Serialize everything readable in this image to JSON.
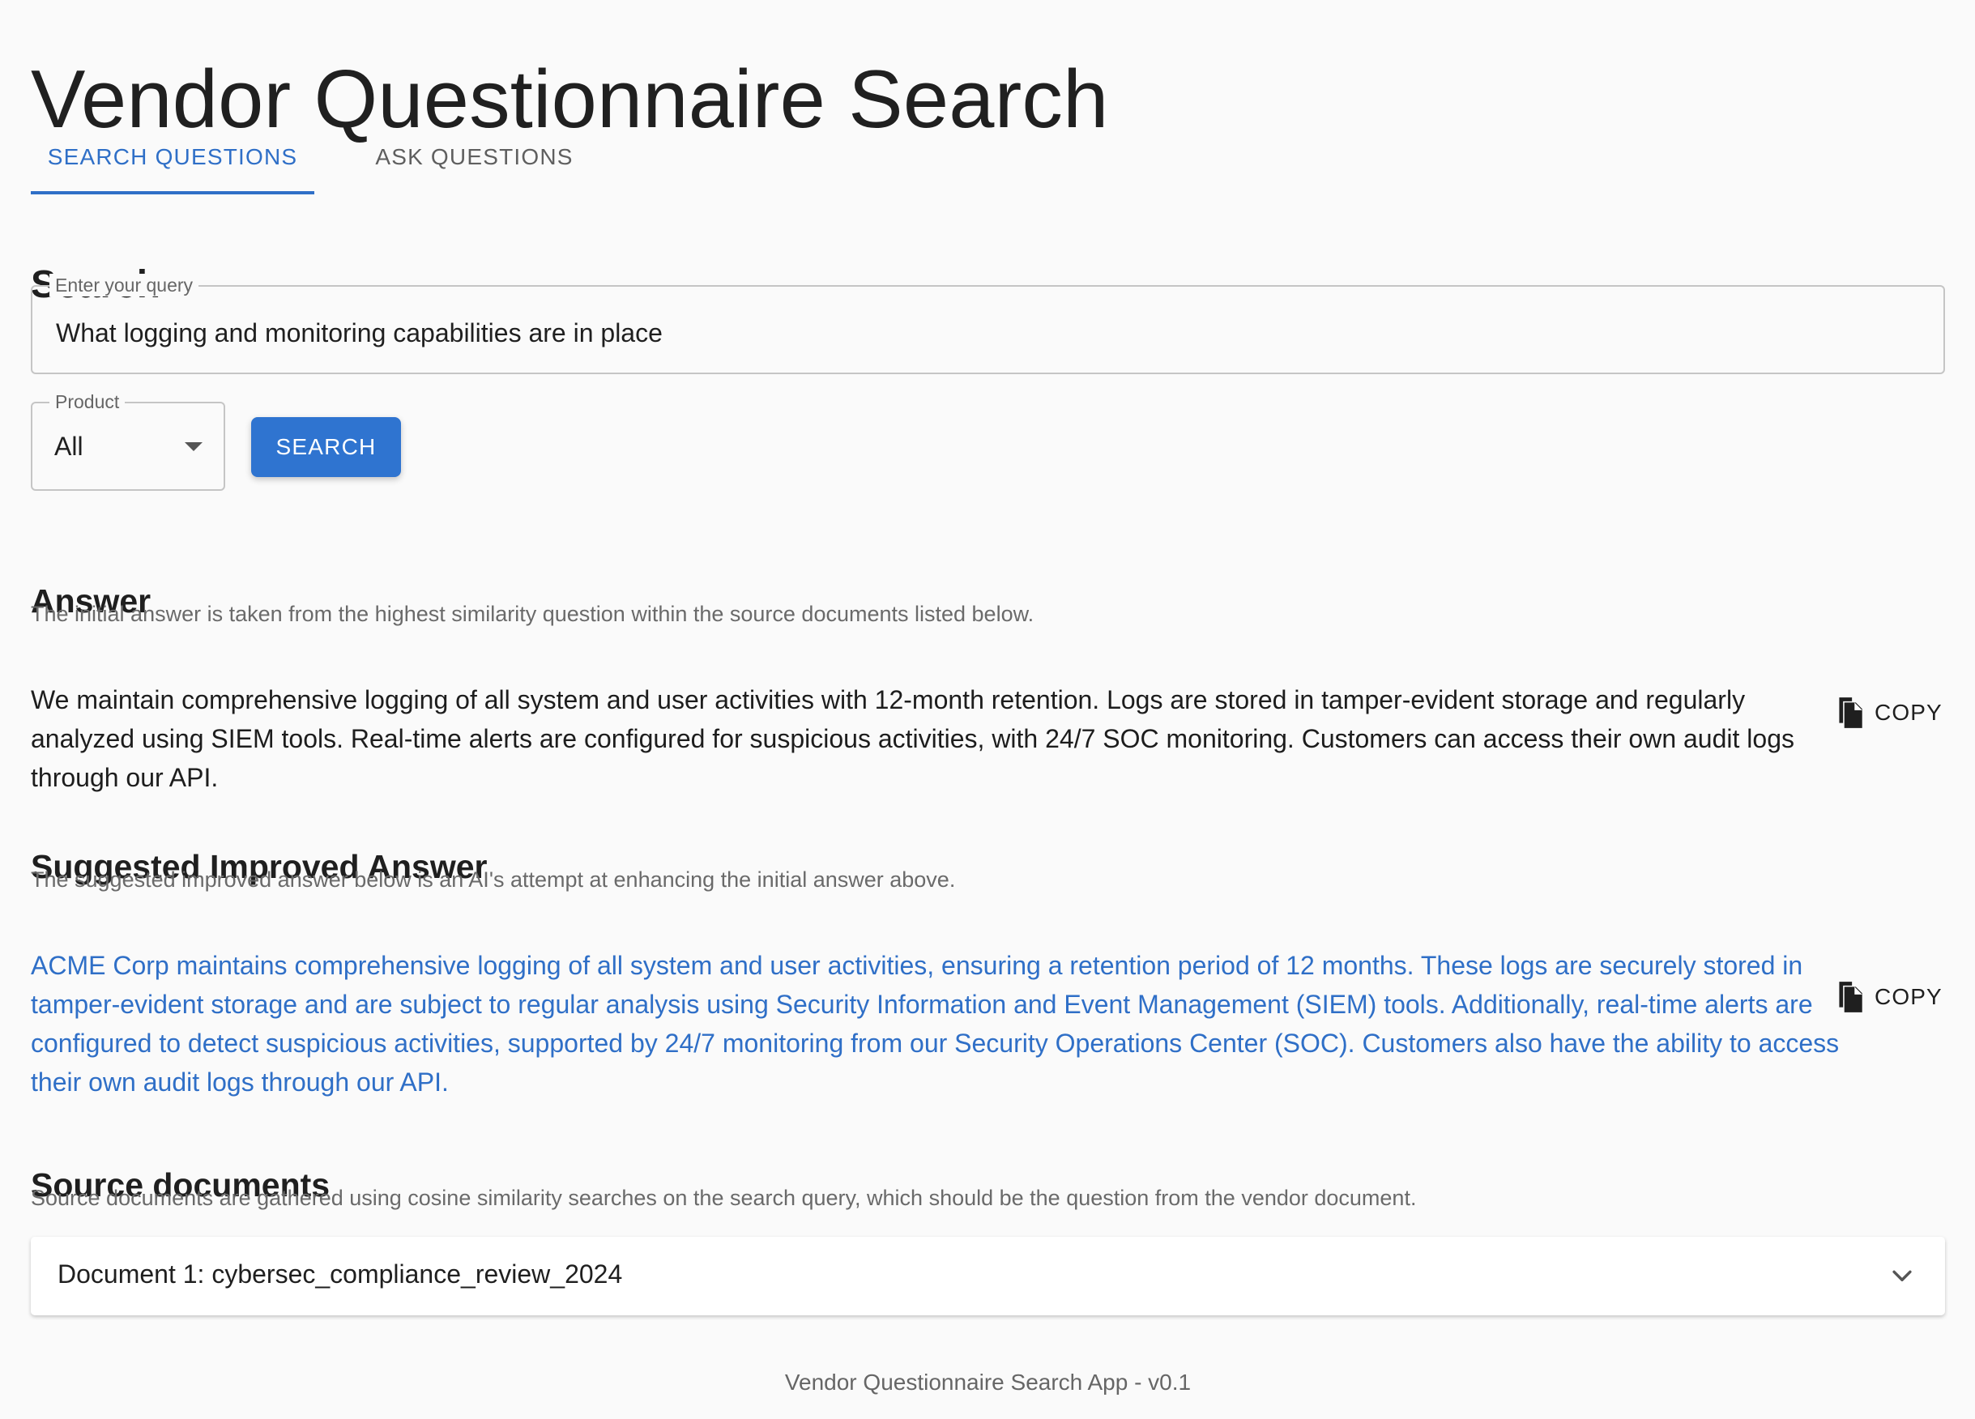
{
  "header": {
    "title": "Vendor Questionnaire Search"
  },
  "tabs": [
    {
      "label": "SEARCH QUESTIONS",
      "active": true
    },
    {
      "label": "ASK QUESTIONS",
      "active": false
    }
  ],
  "search": {
    "title": "Search",
    "query_label": "Enter your query",
    "query_value": "What logging and monitoring capabilities are in place",
    "product_label": "Product",
    "product_value": "All",
    "button_label": "SEARCH"
  },
  "answer": {
    "title": "Answer",
    "description": "The initial answer is taken from the highest similarity question within the source documents listed below.",
    "text": "We maintain comprehensive logging of all system and user activities with 12-month retention. Logs are stored in tamper-evident storage and regularly analyzed using SIEM tools. Real-time alerts are configured for suspicious activities, with 24/7 SOC monitoring. Customers can access their own audit logs through our API.",
    "copy_label": "COPY"
  },
  "improved_answer": {
    "title": "Suggested Improved Answer",
    "description": "The suggested improved answer below is an AI's attempt at enhancing the initial answer above.",
    "text": "ACME Corp maintains comprehensive logging of all system and user activities, ensuring a retention period of 12 months. These logs are securely stored in tamper-evident storage and are subject to regular analysis using Security Information and Event Management (SIEM) tools. Additionally, real-time alerts are configured to detect suspicious activities, supported by 24/7 monitoring from our Security Operations Center (SOC). Customers also have the ability to access their own audit logs through our API.",
    "copy_label": "COPY"
  },
  "sources": {
    "title": "Source documents",
    "description": "Source documents are gathered using cosine similarity searches on the search query, which should be the question from the vendor document.",
    "documents": [
      {
        "label": "Document 1: cybersec_compliance_review_2024"
      }
    ]
  },
  "footer": {
    "text": "Vendor Questionnaire Search App - v0.1"
  },
  "icons": {
    "copy": "copy-icon",
    "dropdown": "chevron-down-icon",
    "expand": "expand-more-icon"
  },
  "colors": {
    "primary": "#2f6fc7",
    "background": "#fafafa",
    "text": "#1f1f1f",
    "muted_text": "#6a6a6a"
  }
}
